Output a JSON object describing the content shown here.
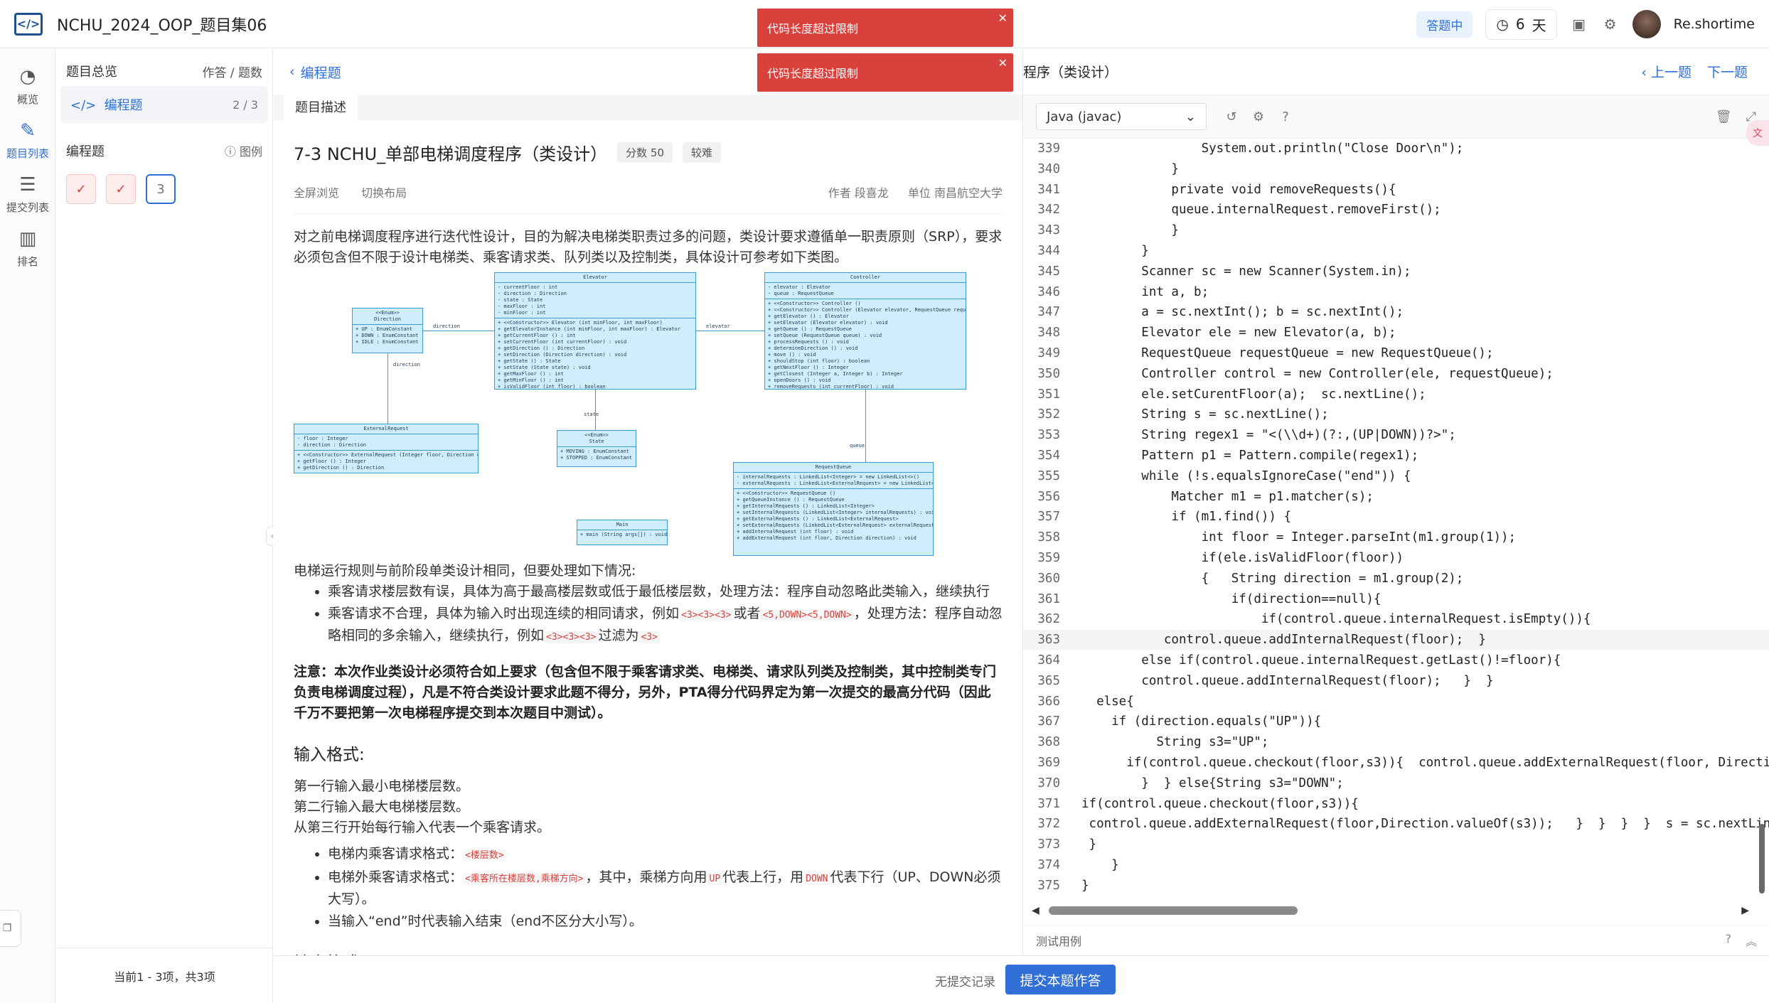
{
  "app": {
    "title": "NCHU_2024_OOP_题目集06",
    "status": "答题中",
    "days_value": "6",
    "days_unit": "天",
    "username": "Re.shortime"
  },
  "toasts": [
    {
      "text": "代码长度超过限制"
    },
    {
      "text": "代码长度超过限制"
    }
  ],
  "rail": [
    {
      "label": "概览",
      "icon": "dashboard-icon"
    },
    {
      "label": "题目列表",
      "icon": "list-icon"
    },
    {
      "label": "提交列表",
      "icon": "submission-icon"
    },
    {
      "label": "排名",
      "icon": "ranking-icon"
    }
  ],
  "nav": {
    "overview_label": "题目总览",
    "overview_right": "作答 / 题数",
    "section_label": "编程题",
    "section_count": "2 / 3",
    "sub_label": "编程题",
    "legend": "图例",
    "problem_boxes": [
      "",
      "",
      "3"
    ],
    "footer": "当前1 - 3项，共3项"
  },
  "problem": {
    "back_label": "编程题",
    "tab_label": "题目描述",
    "title": "7-3 NCHU_单部电梯调度程序（类设计）",
    "score_tag": "分数 50",
    "difficulty_tag": "较难",
    "full_browse": "全屏浏览",
    "switch_layout": "切换布局",
    "author": "作者 段喜龙",
    "unit": "单位 南昌航空大学",
    "intro": "对之前电梯调度程序进行迭代性设计，目的为解决电梯类职责过多的问题，类设计要求遵循单一职责原则（SRP），要求必须包含但不限于设计电梯类、乘客请求类、队列类以及控制类，具体设计可参考如下类图。",
    "rules_intro": "电梯运行规则与前阶段单类设计相同，但要处理如下情况:",
    "rule1": "乘客请求楼层数有误，具体为高于最高楼层数或低于最低楼层数，处理方法：程序自动忽略此类输入，继续执行",
    "rule2_a": "乘客请求不合理，具体为输入时出现连续的相同请求，例如",
    "rule2_code1": "<3><3><3>",
    "rule2_b": "或者",
    "rule2_code2": "<5,DOWN><5,DOWN>",
    "rule2_c": "，处理方法：程序自动忽略相同的多余输入，继续执行，例如",
    "rule2_code3": "<3><3><3>",
    "rule2_d": "过滤为",
    "rule2_code4": "<3>",
    "note": "注意：本次作业类设计必须符合如上要求（包含但不限于乘客请求类、电梯类、请求队列类及控制类，其中控制类专门负责电梯调度过程），凡是不符合类设计要求此题不得分，另外，PTA得分代码界定为第一次提交的最高分代码（因此千万不要把第一次电梯程序提交到本次题目中测试）。",
    "input_heading": "输入格式:",
    "input_line1": "第一行输入最小电梯楼层数。",
    "input_line2": "第二行输入最大电梯楼层数。",
    "input_line3": "从第三行开始每行输入代表一个乘客请求。",
    "req_inner_label": "电梯内乘客请求格式：",
    "req_inner_code": "<楼层数>",
    "req_outer_label": "电梯外乘客请求格式：",
    "req_outer_code": "<乘客所在楼层数,乘梯方向>",
    "req_outer_mid": "，其中，乘梯方向用",
    "req_up_code": "UP",
    "req_outer_mid2": "代表上行，用",
    "req_down_code": "DOWN",
    "req_outer_end": "代表下行（UP、DOWN必须大写）。",
    "end_rule": "当输入“end”时代表输入结束（end不区分大小写）。",
    "output_heading": "输出格式:"
  },
  "uml": {
    "direction": {
      "header": "<<Enum>>\nDirection",
      "body": "+ UP : EnumConstant\n+ DOWN : EnumConstant\n+ IDLE : EnumConstant"
    },
    "elevator": {
      "header": "Elevator",
      "attrs": "- currentFloor : int\n- direction : Direction\n- state : State\n- maxFloor : int\n- minFloor : int",
      "ops": "+ <<Constructor>> Elevator (int minFloor, int maxFloor)\n+ getElevatorInstance (int minFloor, int maxFloor) : Elevator\n+ getCurrentFloor () : int\n+ setCurrentFloor (int currentFloor) : void\n+ getDirection () : Direction\n+ setDirection (Direction direction) : void\n+ getState () : State\n+ setState (State state) : void\n+ getMaxFloor () : int\n+ getMinFloor () : int\n+ isValidFloor (int floor) : boolean"
    },
    "controller": {
      "header": "Controller",
      "attrs": "- elevator : Elevator\n- queue : RequestQueue",
      "ops": "+ <<Constructor>> Controller ()\n+ <<Constructor>> Controller (Elevator elevator, RequestQueue requestQueue)\n+ getElevator () : Elevator\n+ setElevator (Elevator elevator) : void\n+ getQueue () : RequestQueue\n+ setQueue (RequestQueue queue) : void\n+ processRequests () : void\n+ determineDirection () : void\n+ move () : void\n+ shouldStop (int floor) : boolean\n+ getNextFloor () : Integer\n+ getClosest (Integer a, Integer b) : Integer\n+ openDoors () : void\n+ removeRequests (int currentFloor) : void"
    },
    "external": {
      "header": "ExternalRequest",
      "attrs": "- floor : Integer\n- direction : Direction",
      "ops": "+ <<Constructor>> ExternalRequest (Integer floor, Direction direction)\n+ getFloor () : Integer\n+ getDirection () : Direction"
    },
    "state": {
      "header": "<<Enum>>\nState",
      "body": "+ MOVING : EnumConstant\n+ STOPPED : EnumConstant"
    },
    "requestqueue": {
      "header": "RequestQueue",
      "attrs": "- internalRequests : LinkedList<Integer> = new LinkedList<>()\n- externalRequests : LinkedList<ExternalRequest> = new LinkedList<>()",
      "ops": "+ <<Constructor>> RequestQueue ()\n+ getQueueInstance () : RequestQueue\n+ getInternalRequests () : LinkedList<Integer>\n+ setInternalRequests (LinkedList<Integer> internalRequests) : void\n+ getExternalRequests () : LinkedList<ExternalRequest>\n+ setExternalRequests (LinkedList<ExternalRequest> externalRequests) : void\n+ addInternalRequest (int floor) : void\n+ addExternalRequest (int floor, Direction direction) : void"
    },
    "main": {
      "header": "Main",
      "body": "+ main (String args[]) : void"
    },
    "labels": {
      "direction": "direction",
      "direction2": "direction",
      "elevator": "elevator",
      "state": "state",
      "queue": "queue"
    }
  },
  "editor": {
    "title": "程序（类设计）",
    "prev": "上一题",
    "next": "下一题",
    "language": "Java (javac)",
    "test_label": "测试用例",
    "lines": [
      {
        "n": "339",
        "t": "                System.out.println(\"Close Door\\n\");"
      },
      {
        "n": "340",
        "t": "            }"
      },
      {
        "n": "341",
        "t": "            private void removeRequests(){"
      },
      {
        "n": "342",
        "t": "            queue.internalRequest.removeFirst();"
      },
      {
        "n": "343",
        "t": "            }"
      },
      {
        "n": "344",
        "t": "        }"
      },
      {
        "n": "345",
        "t": "        Scanner sc = new Scanner(System.in);"
      },
      {
        "n": "346",
        "t": "        int a, b;"
      },
      {
        "n": "347",
        "t": "        a = sc.nextInt(); b = sc.nextInt();"
      },
      {
        "n": "348",
        "t": "        Elevator ele = new Elevator(a, b);"
      },
      {
        "n": "349",
        "t": "        RequestQueue requestQueue = new RequestQueue();"
      },
      {
        "n": "350",
        "t": "        Controller control = new Controller(ele, requestQueue);"
      },
      {
        "n": "351",
        "t": "        ele.setCurentFloor(a);  sc.nextLine();"
      },
      {
        "n": "352",
        "t": "        String s = sc.nextLine();"
      },
      {
        "n": "353",
        "t": "        String regex1 = \"<(\\\\d+)(?:,(UP|DOWN))?>\";"
      },
      {
        "n": "354",
        "t": "        Pattern p1 = Pattern.compile(regex1);"
      },
      {
        "n": "355",
        "t": "        while (!s.equalsIgnoreCase(\"end\")) {"
      },
      {
        "n": "356",
        "t": "            Matcher m1 = p1.matcher(s);"
      },
      {
        "n": "357",
        "t": "            if (m1.find()) {"
      },
      {
        "n": "358",
        "t": "                int floor = Integer.parseInt(m1.group(1));"
      },
      {
        "n": "359",
        "t": "                if(ele.isValidFloor(floor))"
      },
      {
        "n": "360",
        "t": "                {   String direction = m1.group(2);"
      },
      {
        "n": "361",
        "t": "                    if(direction==null){"
      },
      {
        "n": "362",
        "t": "                        if(control.queue.internalRequest.isEmpty()){"
      },
      {
        "n": "363",
        "t": "           control.queue.addInternalRequest(floor);  }"
      },
      {
        "n": "364",
        "t": "        else if(control.queue.internalRequest.getLast()!=floor){"
      },
      {
        "n": "365",
        "t": "        control.queue.addInternalRequest(floor);   }  }"
      },
      {
        "n": "366",
        "t": "  else{"
      },
      {
        "n": "367",
        "t": "    if (direction.equals(\"UP\")){"
      },
      {
        "n": "368",
        "t": "          String s3=\"UP\";"
      },
      {
        "n": "369",
        "t": "      if(control.queue.checkout(floor,s3)){  control.queue.addExternalRequest(floor, Directi"
      },
      {
        "n": "370",
        "t": "        }  } else{String s3=\"DOWN\";"
      },
      {
        "n": "371",
        "t": "if(control.queue.checkout(floor,s3)){"
      },
      {
        "n": "372",
        "t": " control.queue.addExternalRequest(floor,Direction.valueOf(s3));   }  }  }  }  s = sc.nextLine"
      },
      {
        "n": "373",
        "t": " }"
      },
      {
        "n": "374",
        "t": "    }"
      },
      {
        "n": "375",
        "t": "}"
      }
    ]
  },
  "bottom": {
    "no_submission": "无提交记录",
    "submit_label": "提交本题作答"
  }
}
